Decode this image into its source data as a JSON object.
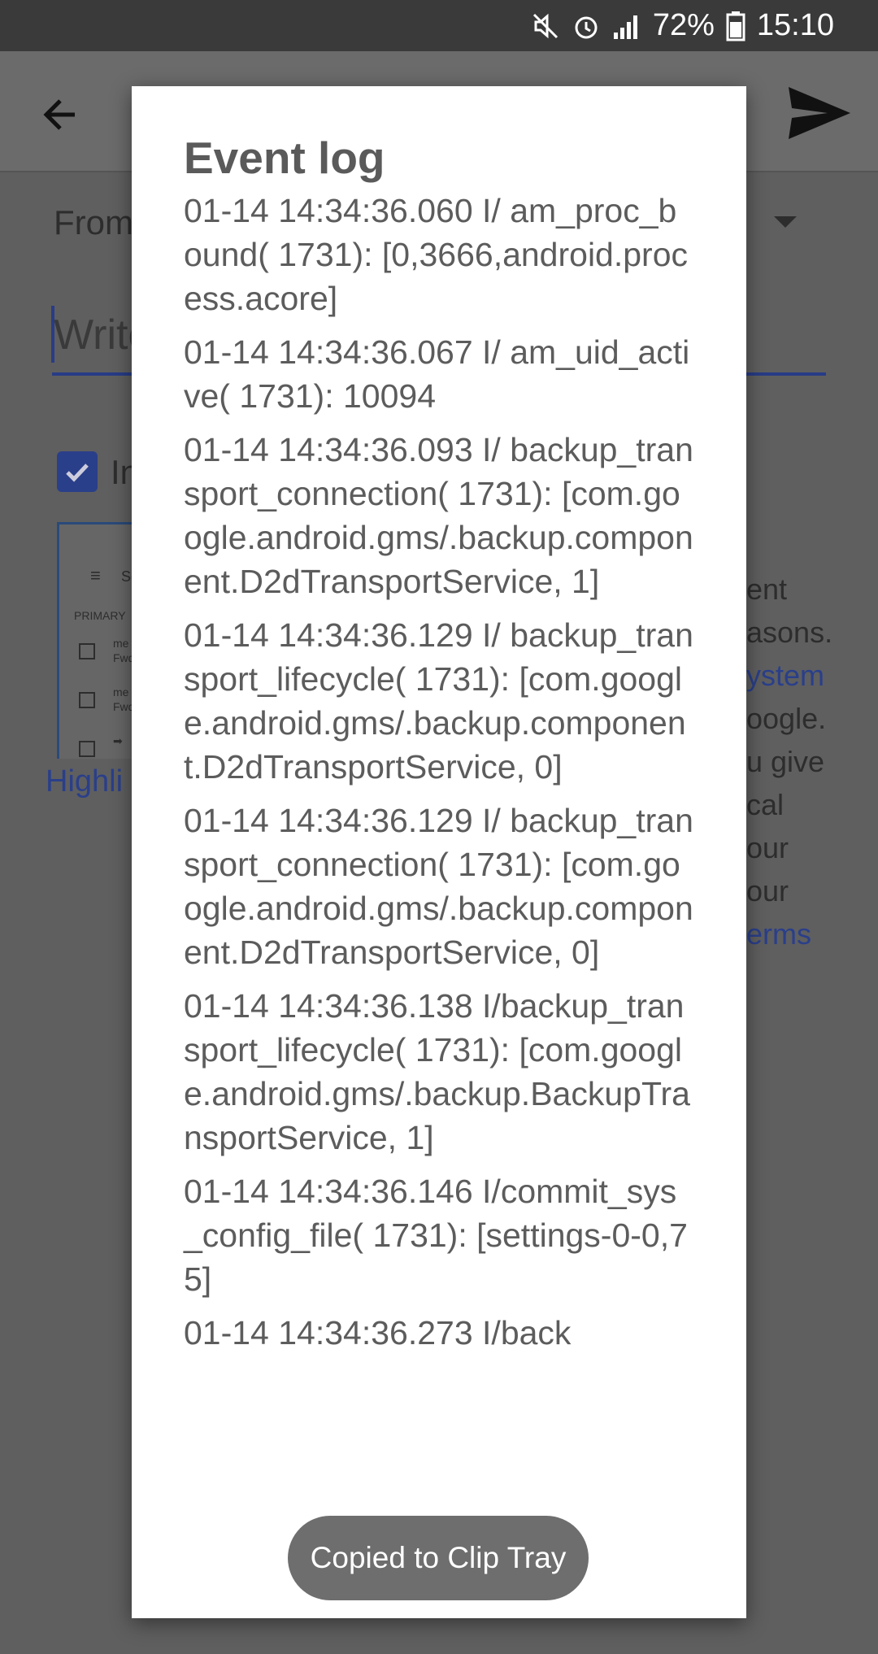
{
  "status_bar": {
    "battery_percent": "72%",
    "time": "15:10",
    "icons": [
      "mute-icon",
      "alarm-icon",
      "signal-icon",
      "battery-icon"
    ]
  },
  "background": {
    "from_label": "From",
    "write_placeholder": "Write",
    "checkbox_partial": "In",
    "highlight_link": "Highli",
    "thumbnail": {
      "menu_label": "Se",
      "section": "PRIMARY",
      "rows": [
        {
          "line1": "me",
          "line2": "Fwd"
        },
        {
          "line1": "me",
          "line2": "Fwd"
        },
        {
          "line1": "➡",
          "line2": ""
        }
      ]
    },
    "right_text_lines": [
      "ent",
      "asons.",
      "ystem",
      "oogle.",
      "u give",
      "cal",
      "our",
      "our",
      "erms"
    ]
  },
  "dialog": {
    "title": "Event log",
    "entries": [
      "01-14 14:34:36.060 I/ am_proc_bound( 1731): [0,3666,android.process.acore]",
      "01-14 14:34:36.067 I/ am_uid_active( 1731): 10094",
      "01-14 14:34:36.093 I/ backup_transport_connection( 1731): [com.google.android.gms/.backup.component.D2dTransportService, 1]",
      "01-14 14:34:36.129 I/ backup_transport_lifecycle( 1731): [com.google.android.gms/.backup.component.D2dTransportService, 0]",
      "01-14 14:34:36.129 I/ backup_transport_connection( 1731): [com.google.android.gms/.backup.component.D2dTransportService, 0]",
      "01-14 14:34:36.138 I/backup_transport_lifecycle( 1731): [com.google.android.gms/.backup.BackupTransportService, 1]",
      "01-14 14:34:36.146 I/commit_sys_config_file( 1731): [settings-0-0,75]",
      "01-14 14:34:36.273 I/back"
    ]
  },
  "toast": {
    "text": "Copied to Clip Tray"
  },
  "colors": {
    "accent": "#2a3f8a",
    "scrim": "#5f5f5f",
    "dialog_bg": "#ffffff",
    "dialog_text": "#5c5c5c"
  }
}
